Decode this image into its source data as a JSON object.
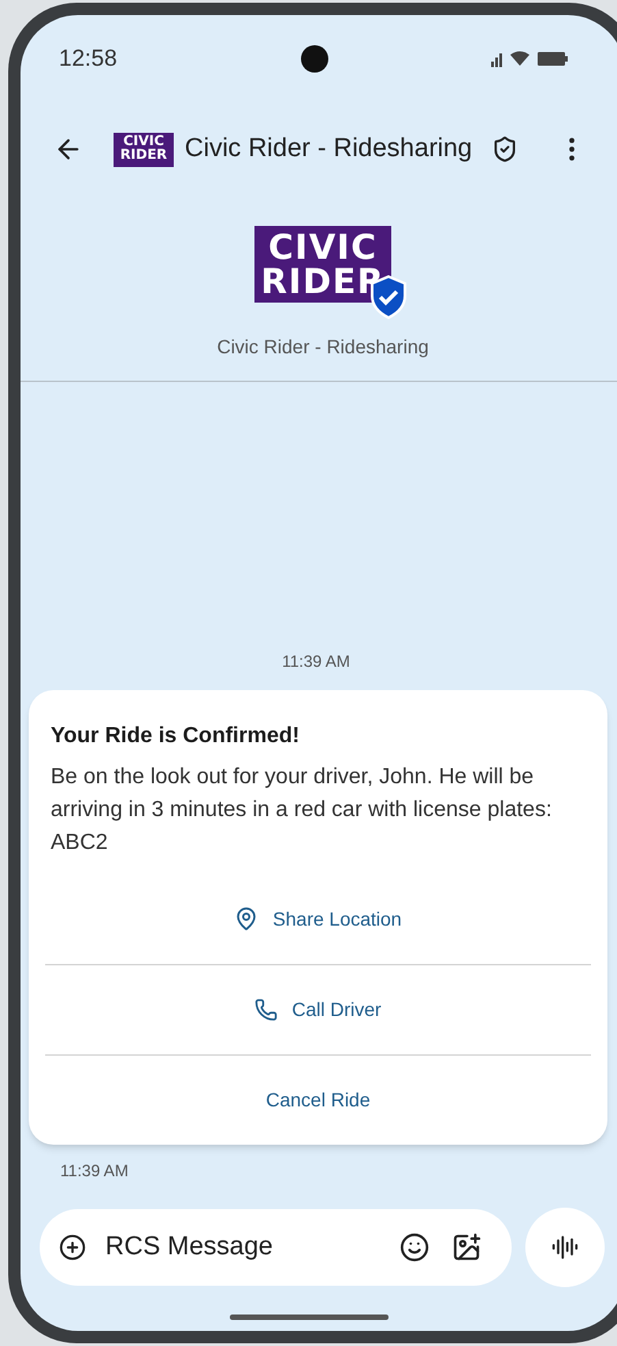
{
  "status_bar": {
    "time": "12:58"
  },
  "header": {
    "logo": [
      "CIVIC",
      "RIDER"
    ],
    "title": "Civic Rider - Ridesharing"
  },
  "profile": {
    "logo": [
      "CIVIC",
      "RIDER"
    ],
    "name": "Civic Rider - Ridesharing"
  },
  "timestamp": "11:39 AM",
  "card": {
    "title": "Your Ride is Confirmed!",
    "body": "Be on the look out for your driver, John. He will be arriving in 3 minutes in a red car with license plates: ABC2",
    "actions": [
      {
        "label": "Share Location",
        "kind": "share"
      },
      {
        "label": "Call Driver",
        "kind": "call"
      },
      {
        "label": "Cancel Ride",
        "kind": "cancel"
      }
    ]
  },
  "message_time": "11:39 AM",
  "composer": {
    "placeholder": "RCS Message"
  }
}
